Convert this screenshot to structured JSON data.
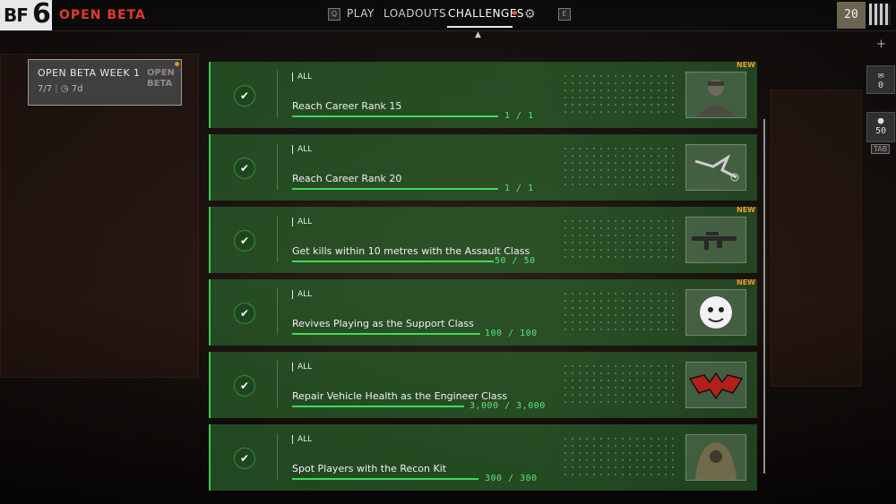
{
  "header": {
    "logo_bf": "BF",
    "logo_six": "6",
    "mode": "OPEN BETA",
    "nav": [
      {
        "key": "Q",
        "label": "PLAY"
      },
      {
        "label": "LOADOUTS"
      },
      {
        "label": "CHALLENGES"
      },
      {
        "key": "E"
      }
    ],
    "rank": "20"
  },
  "sidebar_right": {
    "mail_count": "0",
    "squad_count": "50",
    "squad_key": "TAB"
  },
  "week_card": {
    "title": "OPEN BETA WEEK 1",
    "progress": "7/7",
    "time_left": "7d",
    "badge_line1": "OPEN",
    "badge_line2": "BETA"
  },
  "challenges": [
    {
      "tag": "ALL",
      "name": "Reach Career Rank 15",
      "progress": "1 / 1",
      "new": "NEW",
      "reward_icon": "soldier-skin-icon"
    },
    {
      "tag": "ALL",
      "name": "Reach Career Rank 20",
      "progress": "1 / 1",
      "new": "",
      "reward_icon": "weapon-charm-icon"
    },
    {
      "tag": "ALL",
      "name": "Get kills within 10 metres with the Assault Class",
      "progress": "50 / 50",
      "new": "NEW",
      "reward_icon": "assault-rifle-icon"
    },
    {
      "tag": "ALL",
      "name": "Revives Playing as the Support Class",
      "progress": "100 / 100",
      "new": "NEW",
      "reward_icon": "bulldog-emblem-icon"
    },
    {
      "tag": "ALL",
      "name": "Repair Vehicle Health as the Engineer Class",
      "progress": "3,000 / 3,000",
      "new": "",
      "reward_icon": "bat-emblem-icon"
    },
    {
      "tag": "ALL",
      "name": "Spot Players with the Recon Kit",
      "progress": "300 / 300",
      "new": "",
      "reward_icon": "ghillie-skin-icon"
    }
  ],
  "colors": {
    "accent_red": "#e03a2e",
    "complete_green": "#3ddc5a",
    "new_orange": "#e89b2a"
  }
}
